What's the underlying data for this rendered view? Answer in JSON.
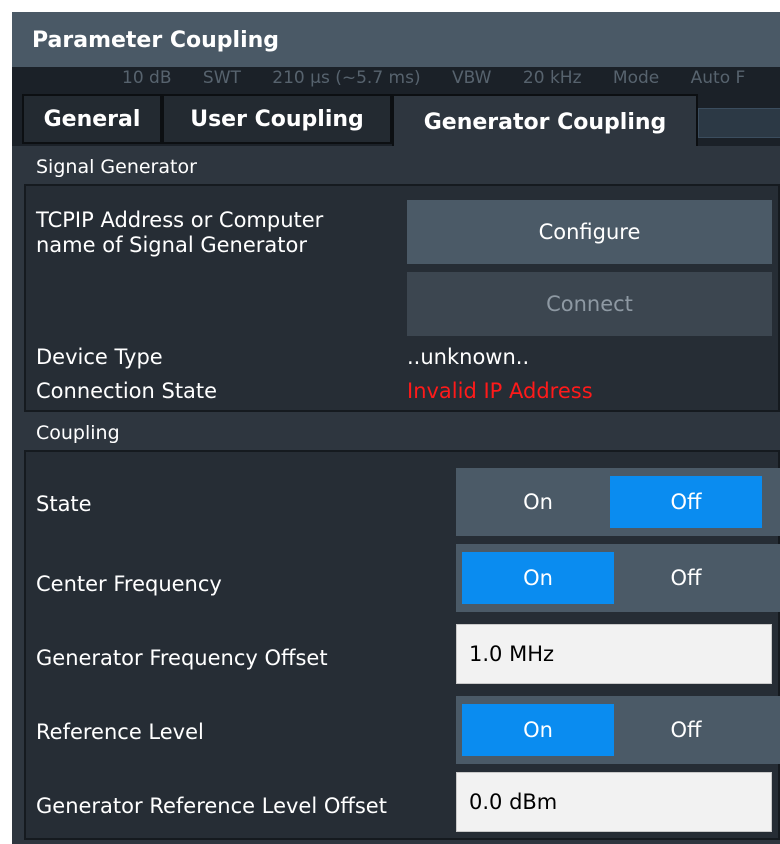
{
  "dialog": {
    "title": "Parameter Coupling",
    "background_items": [
      "10 dB",
      "SWT",
      "210 µs (~5.7 ms)",
      "VBW",
      "20 kHz",
      "Mode",
      "Auto F"
    ]
  },
  "tabs": [
    {
      "label": "General",
      "active": false
    },
    {
      "label": "User Coupling",
      "active": false
    },
    {
      "label": "Generator Coupling",
      "active": true
    }
  ],
  "signal_generator": {
    "section_title": "Signal Generator",
    "address_label_line1": "TCPIP Address or Computer",
    "address_label_line2": "name of Signal Generator",
    "configure_label": "Configure",
    "connect_label": "Connect",
    "device_type_label": "Device Type",
    "device_type_value": "..unknown..",
    "connection_state_label": "Connection State",
    "connection_state_value": "Invalid IP Address"
  },
  "coupling": {
    "section_title": "Coupling",
    "state": {
      "label": "State",
      "on": "On",
      "off": "Off",
      "selected": "Off"
    },
    "center_frequency": {
      "label": "Center Frequency",
      "on": "On",
      "off": "Off",
      "selected": "On"
    },
    "frequency_offset": {
      "label": "Generator Frequency Offset",
      "value": "1.0 MHz"
    },
    "reference_level": {
      "label": "Reference Level",
      "on": "On",
      "off": "Off",
      "selected": "On"
    },
    "level_offset": {
      "label": "Generator Reference Level Offset",
      "value": "0.0 dBm"
    }
  },
  "colors": {
    "title_bar": "#4a5966",
    "dialog_bg": "#2e363f",
    "button": "#4b5a67",
    "selected_toggle": "#0a8cf0",
    "error_text": "#ff1a1a"
  }
}
